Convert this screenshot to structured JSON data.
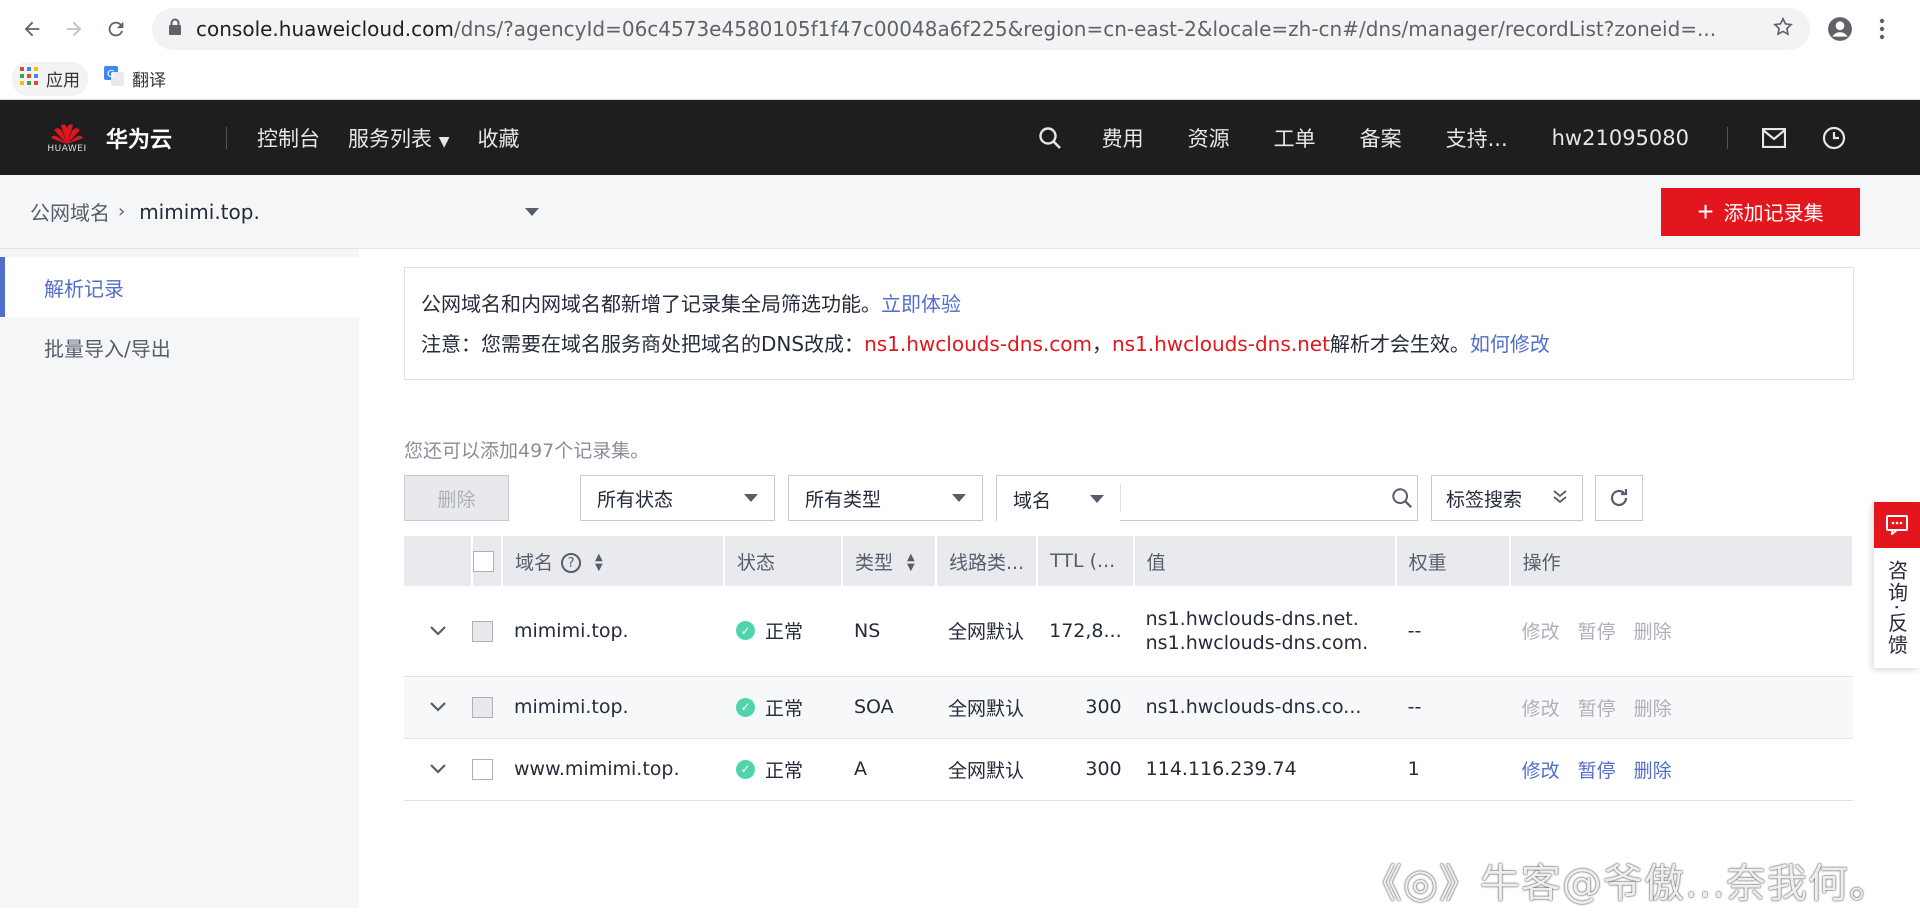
{
  "browser": {
    "url_host": "console.huaweicloud.com",
    "url_path": "/dns/?agencyId=06c4573e4580105f1f47c00048a6f225&region=cn-east-2&locale=zh-cn#/dns/manager/recordList?zoneid=...",
    "bookmarks": {
      "apps": "应用",
      "translate": "翻译"
    }
  },
  "topnav": {
    "logo_sub": "HUAWEI",
    "brand": "华为云",
    "console": "控制台",
    "service_list": "服务列表",
    "favorites": "收藏",
    "fees": "费用",
    "resources": "资源",
    "tickets": "工单",
    "filing": "备案",
    "support": "支持...",
    "username": "hw21095080"
  },
  "breadcrumb": {
    "root": "公网域名",
    "sep": "›",
    "domain": "mimimi.top.",
    "add_button": "添加记录集"
  },
  "sidebar": {
    "items": [
      {
        "label": "解析记录"
      },
      {
        "label": "批量导入/导出"
      }
    ]
  },
  "notice": {
    "line1_text": "公网域名和内网域名都新增了记录集全局筛选功能。",
    "line1_link": "立即体验",
    "line2_prefix": "注意：您需要在域名服务商处把域名的DNS改成：",
    "ns1": "ns1.hwclouds-dns.com",
    "comma": "，",
    "ns2": "ns1.hwclouds-dns.net",
    "line2_suffix": "解析才会生效。",
    "line2_link": "如何修改"
  },
  "remaining_text": "您还可以添加497个记录集。",
  "toolbar": {
    "delete": "删除",
    "status_filter": "所有状态",
    "type_filter": "所有类型",
    "search_field": "域名",
    "search_placeholder": "",
    "tag_search": "标签搜索"
  },
  "table": {
    "headers": {
      "domain": "域名",
      "status": "状态",
      "type": "类型",
      "line": "线路类...",
      "ttl": "TTL (...",
      "value": "值",
      "weight": "权重",
      "ops": "操作"
    },
    "rows": [
      {
        "domain": "mimimi.top.",
        "status": "正常",
        "type": "NS",
        "line": "全网默认",
        "ttl": "172,8...",
        "value1": "ns1.hwclouds-dns.net.",
        "value2": "ns1.hwclouds-dns.com.",
        "weight": "--",
        "edit": "修改",
        "pause": "暂停",
        "del": "删除"
      },
      {
        "domain": "mimimi.top.",
        "status": "正常",
        "type": "SOA",
        "line": "全网默认",
        "ttl": "300",
        "value1": "ns1.hwclouds-dns.co...",
        "weight": "--",
        "edit": "修改",
        "pause": "暂停",
        "del": "删除"
      },
      {
        "domain": "www.mimimi.top.",
        "status": "正常",
        "type": "A",
        "line": "全网默认",
        "ttl": "300",
        "value1": "114.116.239.74",
        "weight": "1",
        "edit": "修改",
        "pause": "暂停",
        "del": "删除"
      }
    ]
  },
  "feedback": {
    "label": "咨询·反馈"
  },
  "watermark": "《◎》牛客@爷傲...奈我何。",
  "colors": {
    "accent": "#526ecc",
    "brand_red": "#e4161d",
    "nav_bg": "#1e1e1e",
    "ok_green": "#50d4ab"
  }
}
